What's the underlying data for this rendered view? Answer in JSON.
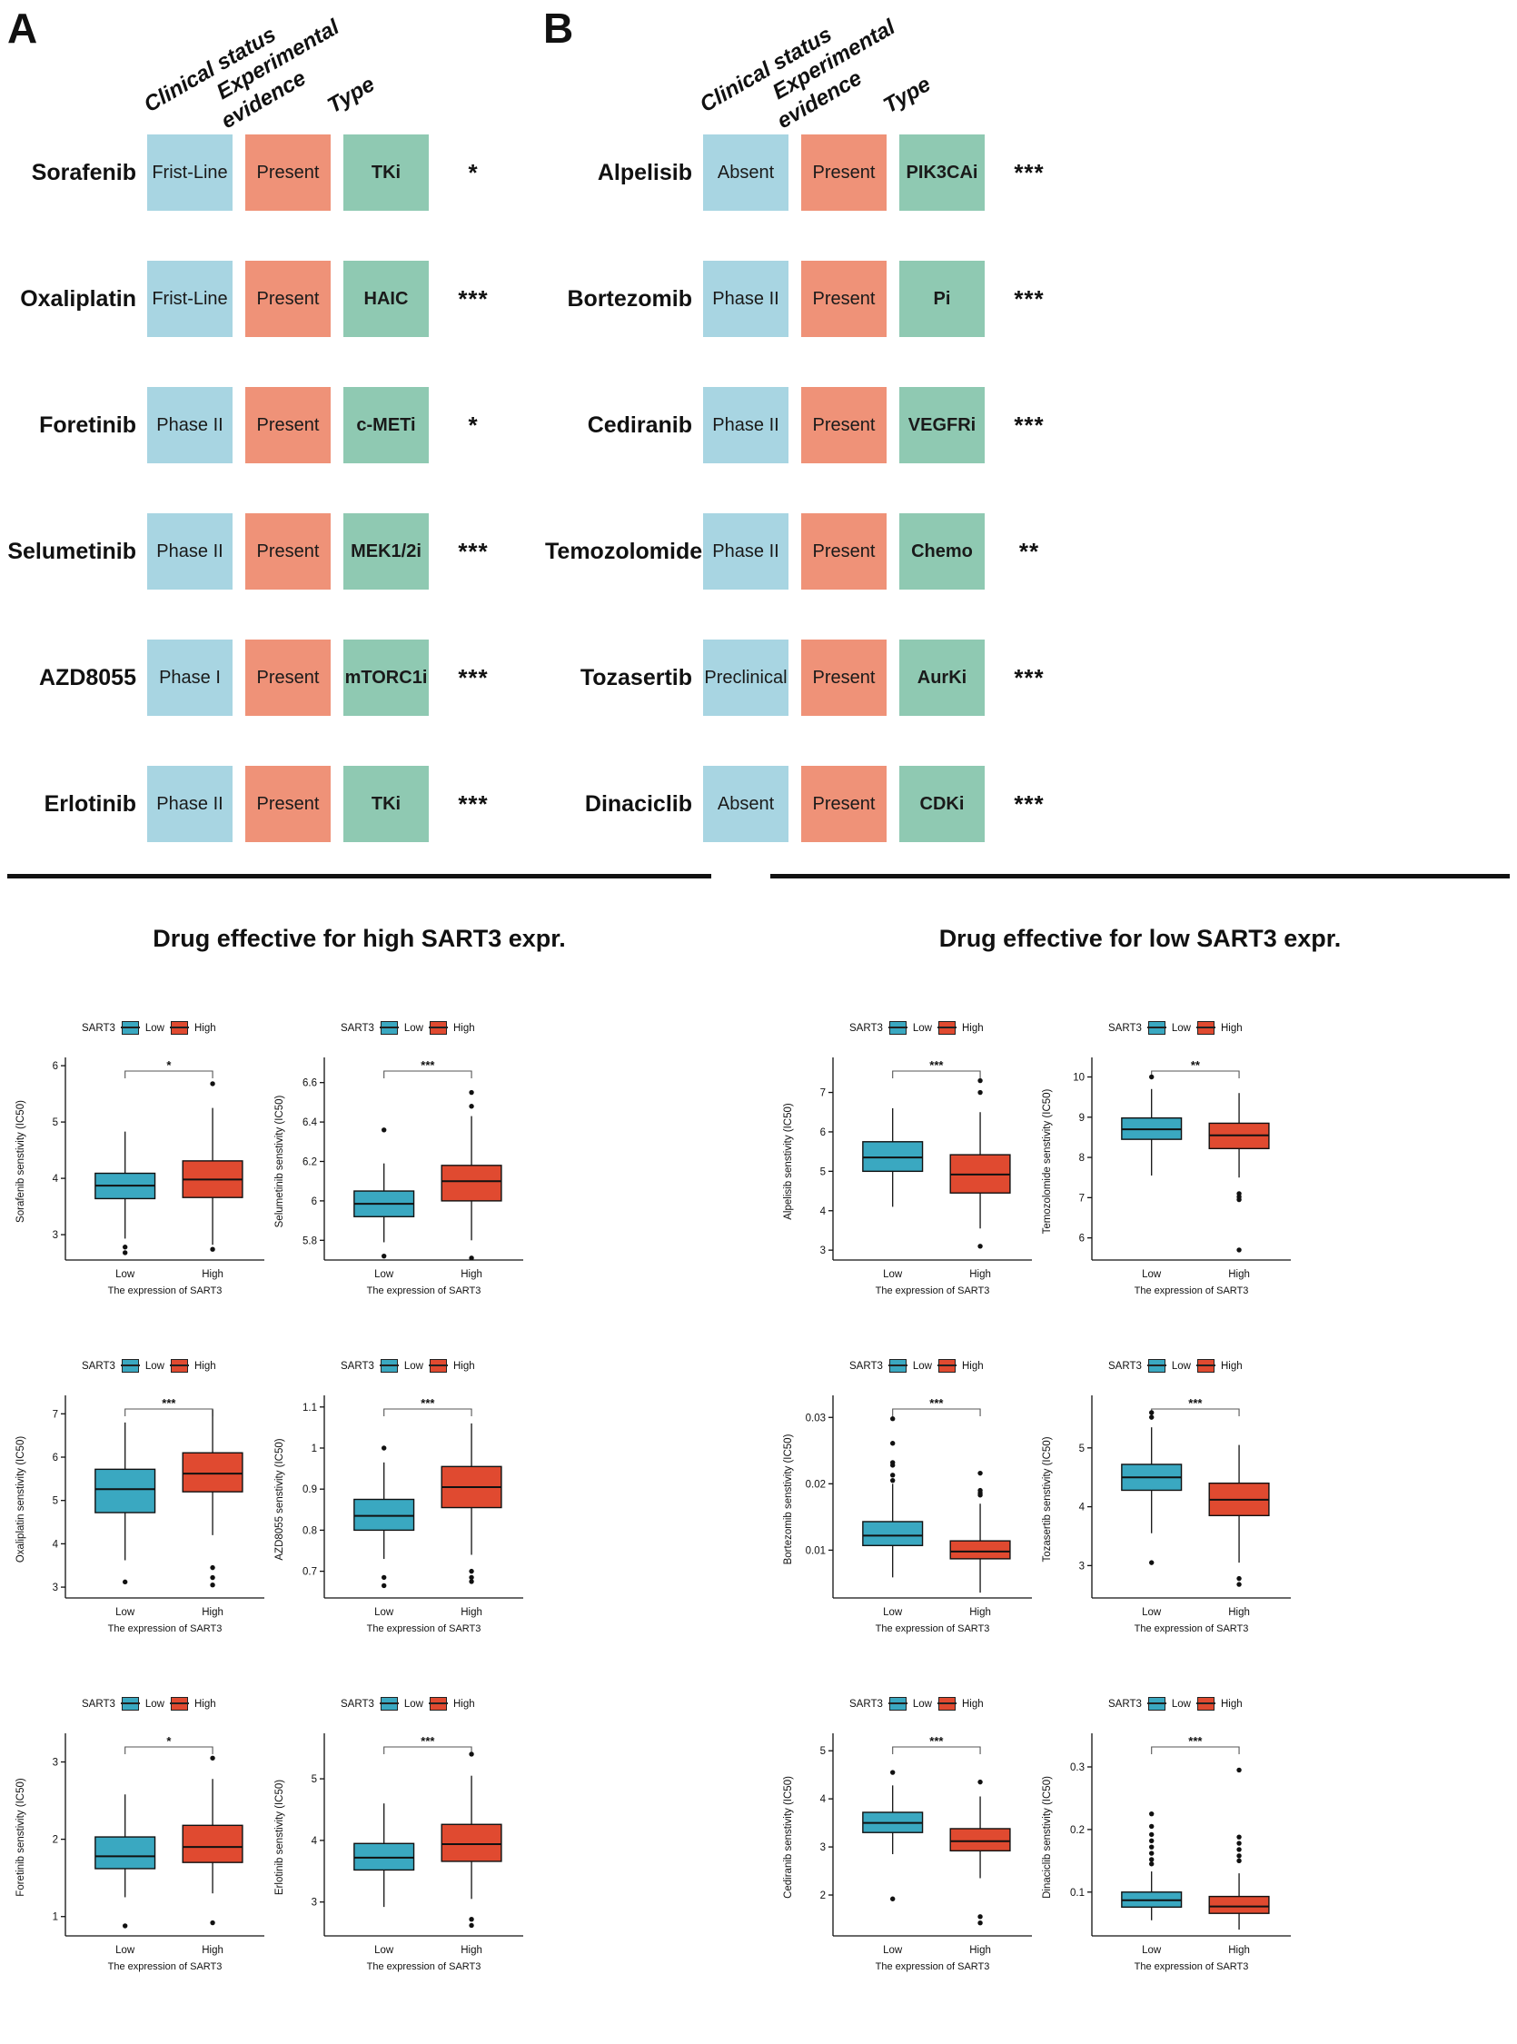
{
  "panels": {
    "a": {
      "letter": "A",
      "section_title": "Drug effective for high SART3 expr.",
      "headers": [
        "Clinical status",
        "Experimental\nevidence",
        "Type"
      ],
      "header_parts": {
        "h1": "Clinical status",
        "h2a": "Experimental",
        "h2b": "evidence",
        "h3": "Type"
      },
      "rows": [
        {
          "drug": "Sorafenib",
          "clinical": "Frist-Line",
          "evidence": "Present",
          "type": "TKi",
          "sig": "*"
        },
        {
          "drug": "Oxaliplatin",
          "clinical": "Frist-Line",
          "evidence": "Present",
          "type": "HAIC",
          "sig": "***"
        },
        {
          "drug": "Foretinib",
          "clinical": "Phase II",
          "evidence": "Present",
          "type": "c-METi",
          "sig": "*"
        },
        {
          "drug": "Selumetinib",
          "clinical": "Phase II",
          "evidence": "Present",
          "type": "MEK1/2i",
          "sig": "***"
        },
        {
          "drug": "AZD8055",
          "clinical": "Phase I",
          "evidence": "Present",
          "type": "mTORC1i",
          "sig": "***"
        },
        {
          "drug": "Erlotinib",
          "clinical": "Phase II",
          "evidence": "Present",
          "type": "TKi",
          "sig": "***"
        }
      ]
    },
    "b": {
      "letter": "B",
      "section_title": "Drug effective for low SART3 expr.",
      "headers": [
        "Clinical status",
        "Experimental\nevidence",
        "Type"
      ],
      "header_parts": {
        "h1": "Clinical status",
        "h2a": "Experimental",
        "h2b": "evidence",
        "h3": "Type"
      },
      "rows": [
        {
          "drug": "Alpelisib",
          "clinical": "Absent",
          "evidence": "Present",
          "type": "PIK3CAi",
          "sig": "***"
        },
        {
          "drug": "Bortezomib",
          "clinical": "Phase II",
          "evidence": "Present",
          "type": "Pi",
          "sig": "***"
        },
        {
          "drug": "Cediranib",
          "clinical": "Phase II",
          "evidence": "Present",
          "type": "VEGFRi",
          "sig": "***"
        },
        {
          "drug": "Temozolomide",
          "clinical": "Phase II",
          "evidence": "Present",
          "type": "Chemo",
          "sig": "**"
        },
        {
          "drug": "Tozasertib",
          "clinical": "Preclinical",
          "evidence": "Present",
          "type": "AurKi",
          "sig": "***"
        },
        {
          "drug": "Dinaciclib",
          "clinical": "Absent",
          "evidence": "Present",
          "type": "CDKi",
          "sig": "***"
        }
      ]
    }
  },
  "colors": {
    "clinical": "#a8d5e2",
    "evidence": "#ef9278",
    "type": "#8fc9b2",
    "low": "#3aa8c1",
    "high": "#e04a30",
    "axis": "#111111"
  },
  "legend": {
    "title": "SART3",
    "low": "Low",
    "high": "High"
  },
  "axis_x_label": "The expression of SART3",
  "x_ticks": [
    "Low",
    "High"
  ],
  "chart_data": [
    {
      "id": "sorafenib",
      "type": "box",
      "title": "",
      "ylabel": "Sorafenib senstivity (IC50)",
      "xlabel": "The expression of SART3",
      "categories": [
        "Low",
        "High"
      ],
      "ylim": [
        2.55,
        6.05
      ],
      "yticks": [
        3,
        4,
        5,
        6
      ],
      "significance": "*",
      "series": [
        {
          "name": "Low",
          "color": "#3aa8c1",
          "min": 2.93,
          "q1": 3.64,
          "median": 3.87,
          "q3": 4.09,
          "max": 4.83,
          "outliers": [
            2.78,
            2.68
          ]
        },
        {
          "name": "High",
          "color": "#e04a30",
          "min": 2.82,
          "q1": 3.66,
          "median": 3.98,
          "q3": 4.31,
          "max": 5.25,
          "outliers": [
            5.68,
            2.74
          ]
        }
      ]
    },
    {
      "id": "selumetinib",
      "type": "box",
      "title": "",
      "ylabel": "Selumetinib senstivity (IC50)",
      "xlabel": "The expression of SART3",
      "categories": [
        "Low",
        "High"
      ],
      "ylim": [
        5.7,
        6.7
      ],
      "yticks": [
        5.8,
        6.0,
        6.2,
        6.4,
        6.6
      ],
      "significance": "***",
      "series": [
        {
          "name": "Low",
          "color": "#3aa8c1",
          "min": 5.79,
          "q1": 5.92,
          "median": 5.985,
          "q3": 6.05,
          "max": 6.19,
          "outliers": [
            6.36,
            5.72
          ]
        },
        {
          "name": "High",
          "color": "#e04a30",
          "min": 5.8,
          "q1": 6.0,
          "median": 6.1,
          "q3": 6.18,
          "max": 6.43,
          "outliers": [
            6.55,
            6.48,
            5.71
          ]
        }
      ]
    },
    {
      "id": "oxaliplatin",
      "type": "box",
      "title": "",
      "ylabel": "Oxaliplatin senstivity (IC50)",
      "xlabel": "The expression of SART3",
      "categories": [
        "Low",
        "High"
      ],
      "ylim": [
        2.75,
        7.3
      ],
      "yticks": [
        3,
        4,
        5,
        6,
        7
      ],
      "significance": "***",
      "series": [
        {
          "name": "Low",
          "color": "#3aa8c1",
          "min": 3.62,
          "q1": 4.72,
          "median": 5.26,
          "q3": 5.72,
          "max": 6.8,
          "outliers": [
            3.12
          ]
        },
        {
          "name": "High",
          "color": "#e04a30",
          "min": 4.2,
          "q1": 5.2,
          "median": 5.62,
          "q3": 6.1,
          "max": 7.1,
          "outliers": [
            3.45,
            3.22,
            3.05
          ]
        }
      ]
    },
    {
      "id": "azd8055",
      "type": "box",
      "title": "",
      "ylabel": "AZD8055 senstivity (IC50)",
      "xlabel": "The expression of SART3",
      "categories": [
        "Low",
        "High"
      ],
      "ylim": [
        0.635,
        1.115
      ],
      "yticks": [
        0.7,
        0.8,
        0.9,
        1.0,
        1.1
      ],
      "significance": "***",
      "series": [
        {
          "name": "Low",
          "color": "#3aa8c1",
          "min": 0.73,
          "q1": 0.8,
          "median": 0.835,
          "q3": 0.875,
          "max": 0.965,
          "outliers": [
            1.0,
            0.685,
            0.665
          ]
        },
        {
          "name": "High",
          "color": "#e04a30",
          "min": 0.74,
          "q1": 0.855,
          "median": 0.905,
          "q3": 0.955,
          "max": 1.06,
          "outliers": [
            0.7,
            0.685,
            0.675
          ]
        }
      ]
    },
    {
      "id": "foretinib",
      "type": "box",
      "title": "",
      "ylabel": "Foretinib senstivity (IC50)",
      "xlabel": "The expression of SART3",
      "categories": [
        "Low",
        "High"
      ],
      "ylim": [
        0.75,
        3.3
      ],
      "yticks": [
        1,
        2,
        3
      ],
      "significance": "*",
      "series": [
        {
          "name": "Low",
          "color": "#3aa8c1",
          "min": 1.25,
          "q1": 1.62,
          "median": 1.78,
          "q3": 2.03,
          "max": 2.58,
          "outliers": [
            0.88
          ]
        },
        {
          "name": "High",
          "color": "#e04a30",
          "min": 1.3,
          "q1": 1.7,
          "median": 1.9,
          "q3": 2.18,
          "max": 2.78,
          "outliers": [
            3.05,
            0.92
          ]
        }
      ]
    },
    {
      "id": "erlotinib",
      "type": "box",
      "title": "",
      "ylabel": "Erlotinib senstivity (IC50)",
      "xlabel": "The expression of SART3",
      "categories": [
        "Low",
        "High"
      ],
      "ylim": [
        2.45,
        5.65
      ],
      "yticks": [
        3,
        4,
        5
      ],
      "significance": "***",
      "series": [
        {
          "name": "Low",
          "color": "#3aa8c1",
          "min": 2.92,
          "q1": 3.52,
          "median": 3.72,
          "q3": 3.95,
          "max": 4.6,
          "outliers": []
        },
        {
          "name": "High",
          "color": "#e04a30",
          "min": 3.05,
          "q1": 3.66,
          "median": 3.94,
          "q3": 4.26,
          "max": 5.05,
          "outliers": [
            5.4,
            2.72,
            2.62
          ]
        }
      ]
    },
    {
      "id": "alpelisib",
      "type": "box",
      "title": "",
      "ylabel": "Alpelisib senstivity (IC50)",
      "xlabel": "The expression of SART3",
      "categories": [
        "Low",
        "High"
      ],
      "ylim": [
        2.75,
        7.75
      ],
      "yticks": [
        3,
        4,
        5,
        6,
        7
      ],
      "significance": "***",
      "series": [
        {
          "name": "Low",
          "color": "#3aa8c1",
          "min": 4.1,
          "q1": 5.0,
          "median": 5.35,
          "q3": 5.75,
          "max": 6.6,
          "outliers": []
        },
        {
          "name": "High",
          "color": "#e04a30",
          "min": 3.55,
          "q1": 4.45,
          "median": 4.92,
          "q3": 5.42,
          "max": 6.5,
          "outliers": [
            7.3,
            7.0,
            3.1
          ]
        }
      ]
    },
    {
      "id": "temozolomide",
      "type": "box",
      "title": "",
      "ylabel": "Temozolomide senstivity (IC50)",
      "xlabel": "The expression of SART3",
      "categories": [
        "Low",
        "High"
      ],
      "ylim": [
        5.45,
        10.35
      ],
      "yticks": [
        6,
        7,
        8,
        9,
        10
      ],
      "significance": "**",
      "series": [
        {
          "name": "Low",
          "color": "#3aa8c1",
          "min": 7.55,
          "q1": 8.45,
          "median": 8.7,
          "q3": 8.98,
          "max": 9.7,
          "outliers": [
            10.0
          ]
        },
        {
          "name": "High",
          "color": "#e04a30",
          "min": 7.5,
          "q1": 8.22,
          "median": 8.55,
          "q3": 8.85,
          "max": 9.6,
          "outliers": [
            7.1,
            7.02,
            6.95,
            5.7
          ]
        }
      ]
    },
    {
      "id": "bortezomib",
      "type": "box",
      "title": "",
      "ylabel": "Bortezomib senstivity (IC50)",
      "xlabel": "The expression of SART3",
      "categories": [
        "Low",
        "High"
      ],
      "ylim": [
        0.0028,
        0.0325
      ],
      "yticks": [
        0.01,
        0.02,
        0.03
      ],
      "significance": "***",
      "series": [
        {
          "name": "Low",
          "color": "#3aa8c1",
          "min": 0.0059,
          "q1": 0.0107,
          "median": 0.0122,
          "q3": 0.0143,
          "max": 0.02,
          "outliers": [
            0.0298,
            0.0261,
            0.0232,
            0.0228,
            0.0213,
            0.0205
          ]
        },
        {
          "name": "High",
          "color": "#e04a30",
          "min": 0.0036,
          "q1": 0.0087,
          "median": 0.0098,
          "q3": 0.0114,
          "max": 0.017,
          "outliers": [
            0.0216,
            0.019,
            0.0186,
            0.0183
          ]
        }
      ]
    },
    {
      "id": "tozasertib",
      "type": "box",
      "title": "",
      "ylabel": "Tozasertib senstivity (IC50)",
      "xlabel": "The expression of SART3",
      "categories": [
        "Low",
        "High"
      ],
      "ylim": [
        2.45,
        5.8
      ],
      "yticks": [
        3,
        4,
        5
      ],
      "significance": "***",
      "series": [
        {
          "name": "Low",
          "color": "#3aa8c1",
          "min": 3.55,
          "q1": 4.28,
          "median": 4.5,
          "q3": 4.72,
          "max": 5.35,
          "outliers": [
            5.6,
            5.52,
            3.05
          ]
        },
        {
          "name": "High",
          "color": "#e04a30",
          "min": 3.05,
          "q1": 3.85,
          "median": 4.12,
          "q3": 4.4,
          "max": 5.05,
          "outliers": [
            2.78,
            2.68
          ]
        }
      ]
    },
    {
      "id": "cediranib",
      "type": "box",
      "title": "",
      "ylabel": "Cediranib senstivity (IC50)",
      "xlabel": "The expression of SART3",
      "categories": [
        "Low",
        "High"
      ],
      "ylim": [
        1.15,
        5.25
      ],
      "yticks": [
        2,
        3,
        4,
        5
      ],
      "significance": "***",
      "series": [
        {
          "name": "Low",
          "color": "#3aa8c1",
          "min": 2.85,
          "q1": 3.3,
          "median": 3.5,
          "q3": 3.72,
          "max": 4.28,
          "outliers": [
            4.55,
            1.92
          ]
        },
        {
          "name": "High",
          "color": "#e04a30",
          "min": 2.35,
          "q1": 2.92,
          "median": 3.12,
          "q3": 3.38,
          "max": 4.05,
          "outliers": [
            4.35,
            1.55,
            1.42
          ]
        }
      ]
    },
    {
      "id": "dinaciclib",
      "type": "box",
      "title": "",
      "ylabel": "Dinaciclib senstivity (IC50)",
      "xlabel": "The expression of SART3",
      "categories": [
        "Low",
        "High"
      ],
      "ylim": [
        0.03,
        0.345
      ],
      "yticks": [
        0.1,
        0.2,
        0.3
      ],
      "significance": "***",
      "series": [
        {
          "name": "Low",
          "color": "#3aa8c1",
          "min": 0.055,
          "q1": 0.076,
          "median": 0.087,
          "q3": 0.1,
          "max": 0.133,
          "outliers": [
            0.225,
            0.205,
            0.192,
            0.182,
            0.172,
            0.162,
            0.152,
            0.145
          ]
        },
        {
          "name": "High",
          "color": "#e04a30",
          "min": 0.04,
          "q1": 0.066,
          "median": 0.077,
          "q3": 0.093,
          "max": 0.13,
          "outliers": [
            0.295,
            0.188,
            0.178,
            0.168,
            0.158,
            0.15
          ]
        }
      ]
    }
  ]
}
